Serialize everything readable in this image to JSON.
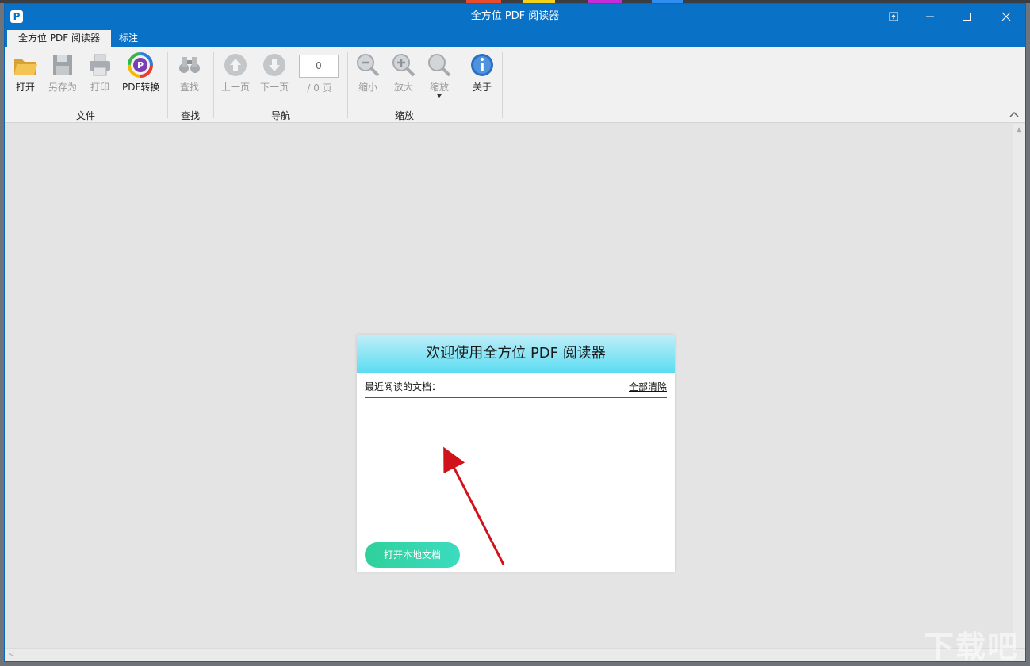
{
  "window": {
    "title": "全方位 PDF 阅读器",
    "app_icon": "P",
    "controls": [
      "pin-icon",
      "minimize-icon",
      "maximize-icon",
      "close-icon"
    ]
  },
  "tabs": [
    {
      "label": "全方位 PDF 阅读器",
      "active": true
    },
    {
      "label": "标注",
      "active": false
    }
  ],
  "ribbon": {
    "file": {
      "group_label": "文件",
      "open": "打开",
      "save_as": "另存为",
      "print": "打印",
      "convert": "PDF转换"
    },
    "find": {
      "group_label": "查找",
      "find": "查找"
    },
    "nav": {
      "group_label": "导航",
      "prev": "上一页",
      "next": "下一页",
      "page_value": "0",
      "page_total": "/ 0 页"
    },
    "zoom": {
      "group_label": "缩放",
      "zoom_out": "缩小",
      "zoom_in": "放大",
      "zoom": "缩放"
    },
    "about": {
      "about": "关于"
    }
  },
  "welcome": {
    "title": "欢迎使用全方位 PDF 阅读器",
    "recent_label": "最近阅读的文档：",
    "clear_all": "全部清除",
    "recent_items": [],
    "open_local": "打开本地文档"
  },
  "watermark": "下载吧",
  "colors": {
    "titlebar": "#0a72c6",
    "button": "#2fd09b",
    "arrow": "#d0121b"
  }
}
